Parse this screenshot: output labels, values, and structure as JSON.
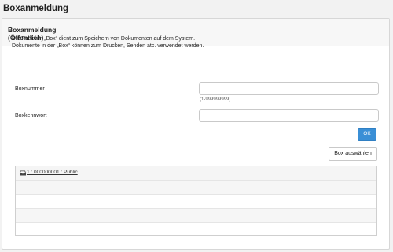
{
  "page": {
    "title": "Boxanmeldung"
  },
  "panel": {
    "title": "Boxanmeldung\n(Öffentlich)",
    "description": "Die Funktion „Box“ dient zum Speichern  von Dokumenten auf dem System. Dokumente in der „Box“ können zum Drucken, Senden atc. verwendet werden."
  },
  "form": {
    "boxnummer_label": "Boxnummer",
    "boxnummer_value": "",
    "boxnummer_hint": "(1-999999999)",
    "boxkennwort_label": "Boxkennwort",
    "boxkennwort_value": "",
    "ok_label": "OK"
  },
  "box_select_label": "Box auswählen",
  "box_list": {
    "items": [
      {
        "label": "1 : 000000001 : Public",
        "icon": "inbox-icon"
      }
    ]
  },
  "colors": {
    "ok_button": "#3a8fd6"
  }
}
